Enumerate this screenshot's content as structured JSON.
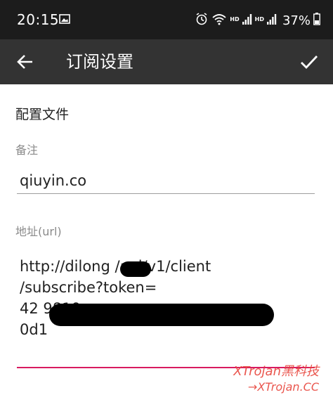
{
  "status_bar": {
    "time": "20:15",
    "network_type": "HD",
    "network_type_2": "HD",
    "battery": "37%"
  },
  "app_bar": {
    "title": "订阅设置"
  },
  "form": {
    "section_title": "配置文件",
    "remark": {
      "label": "备注",
      "value": "qiuyin.co"
    },
    "url": {
      "label": "地址(url)",
      "lines": [
        "http://dilong    /api/v1/client",
        "/subscribe?token=",
        "42                                              9810",
        "0d1"
      ]
    }
  },
  "watermark": {
    "line1": "XTrojan黑科技",
    "line2": "→XTrojan.CC"
  },
  "colors": {
    "status_bar_bg": "#1c1c1c",
    "app_bar_bg": "#333333",
    "accent": "#d81b60",
    "watermark": "#e8453c"
  }
}
